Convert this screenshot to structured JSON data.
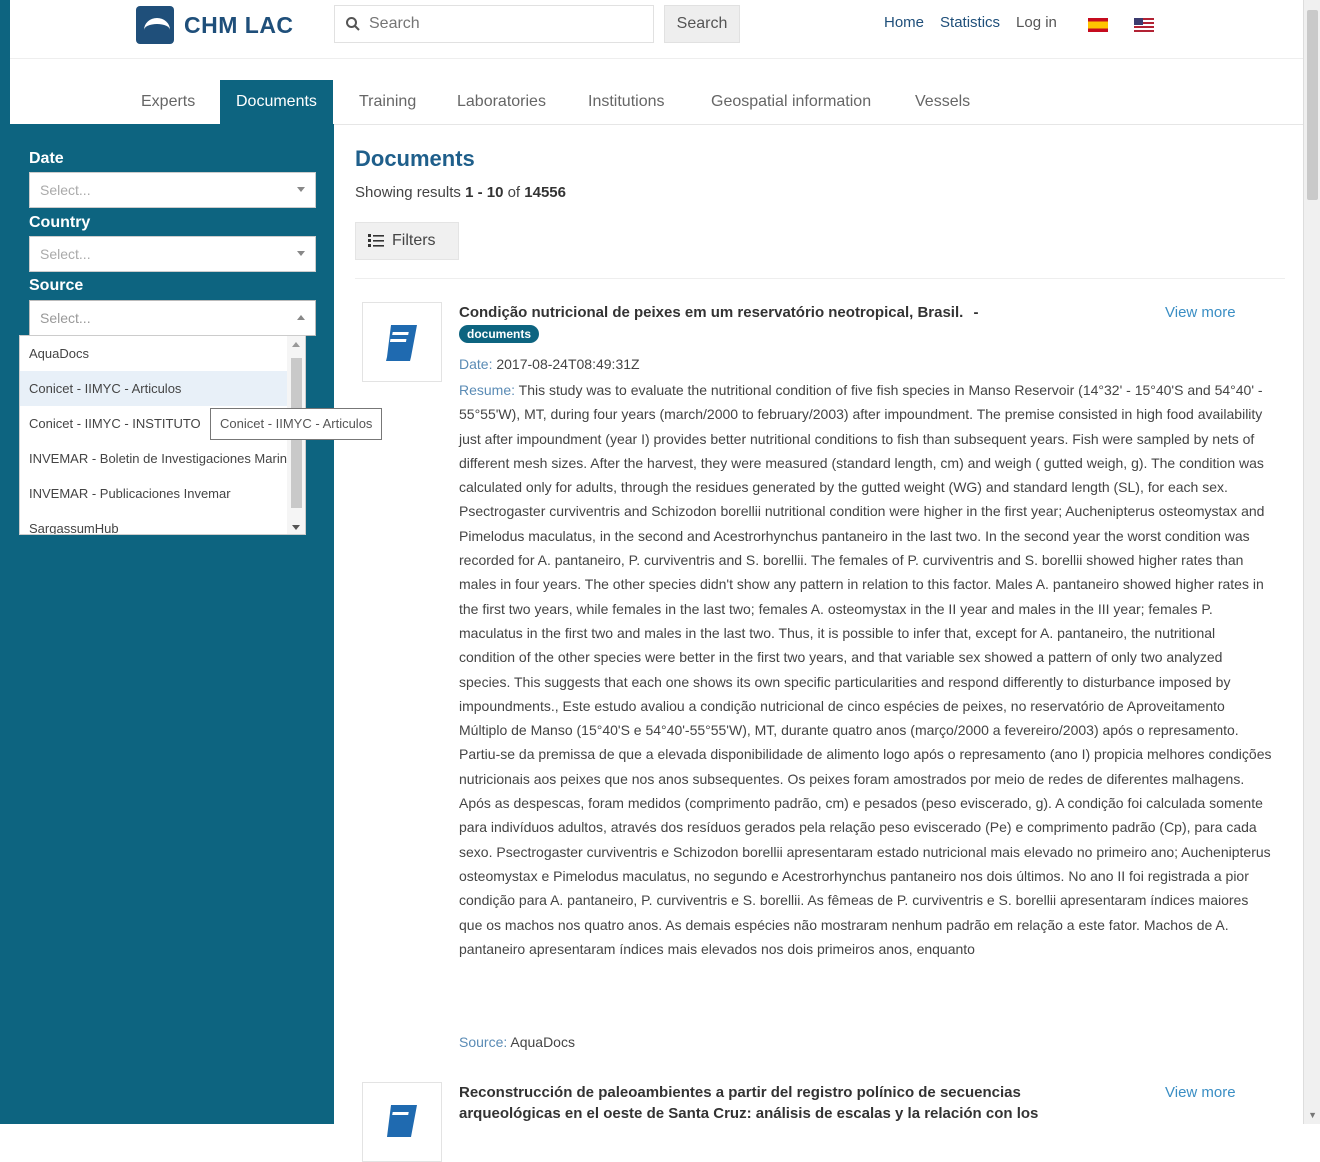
{
  "header": {
    "logo_text": "CHM LAC",
    "search_placeholder": "Search",
    "search_button": "Search",
    "nav": [
      "Home",
      "Statistics",
      "Log in"
    ]
  },
  "tabs": [
    "Experts",
    "Documents",
    "Training",
    "Laboratories",
    "Institutions",
    "Geospatial information",
    "Vessels"
  ],
  "active_tab": "Documents",
  "sidebar": {
    "date": {
      "label": "Date",
      "placeholder": "Select..."
    },
    "country": {
      "label": "Country",
      "placeholder": "Select..."
    },
    "source": {
      "label": "Source",
      "placeholder": "Select...",
      "options": [
        "AquaDocs",
        "Conicet - IIMYC - Articulos",
        "Conicet - IIMYC - INSTITUTO",
        "INVEMAR - Boletin de Investigaciones Marinas",
        "INVEMAR - Publicaciones Invemar",
        "SargassumHub"
      ],
      "hovered_option": "Conicet - IIMYC - Articulos",
      "tooltip": "Conicet - IIMYC - Articulos"
    }
  },
  "main": {
    "title": "Documents",
    "results_prefix": "Showing results",
    "results_range": "1 - 10",
    "results_of": "of",
    "results_total": "14556",
    "filters_button": "Filters",
    "documents": [
      {
        "title": "Condição nutricional de peixes em um reservatório neotropical, Brasil.",
        "title_suffix": "-",
        "badge": "documents",
        "view_more": "View more",
        "date_label": "Date:",
        "date": "2017-08-24T08:49:31Z",
        "resume_label": "Resume:",
        "resume": "This study was to evaluate the nutritional condition of five fish species in Manso Reservoir (14°32' - 15°40'S and 54°40' - 55°55'W), MT, during four years (march/2000 to february/2003) after impoundment. The premise consisted in high food availability just after impoundment (year I) provides better nutritional conditions to fish than subsequent years. Fish were sampled by nets of different mesh sizes. After the harvest, they were measured (standard length, cm) and weigh ( gutted weigh, g). The condition was calculated only for adults, through the residues generated by the gutted weight (WG) and standard length (SL), for each sex. Psectrogaster curviventris and Schizodon borellii nutritional condition were higher in the first year; Auchenipterus osteomystax and Pimelodus maculatus, in the second and Acestrorhynchus pantaneiro in the last two. In the second year the worst condition was recorded for A. pantaneiro, P. curviventris and S. borellii. The females of P. curviventris and S. borellii showed higher rates than males in four years. The other species didn't show any pattern in relation to this factor. Males A. pantaneiro showed higher rates in the first two years, while females in the last two; females A. osteomystax in the II year and males in the III year; females P. maculatus in the first two and males in the last two. Thus, it is possible to infer that, except for A. pantaneiro, the nutritional condition of the other species were better in the first two years, and that variable sex showed a pattern of only two analyzed species. This suggests that each one shows its own specific particularities and respond differently to disturbance imposed by impoundments., Este estudo avaliou a condição nutricional de cinco espécies de peixes, no reservatório de Aproveitamento Múltiplo de Manso (15°40'S e 54°40'-55°55'W), MT, durante quatro anos (março/2000 a fevereiro/2003) após o represamento. Partiu-se da premissa de que a elevada disponibilidade de alimento logo após o represamento (ano I) propicia melhores condições nutricionais aos peixes que nos anos subsequentes. Os peixes foram amostrados por meio de redes de diferentes malhagens. Após as despescas, foram medidos (comprimento padrão, cm) e pesados (peso eviscerado, g). A condição foi calculada somente para indivíduos adultos, através dos resíduos gerados pela relação peso eviscerado (Pe) e comprimento padrão (Cp), para cada sexo. Psectrogaster curviventris e Schizodon borellii apresentaram estado nutricional mais elevado no primeiro ano; Auchenipterus osteomystax e Pimelodus maculatus, no segundo e Acestrorhynchus pantaneiro nos dois últimos. No ano II foi registrada a pior condição para A. pantaneiro, P. curviventris e S. borellii. As fêmeas de P. curviventris e S. borellii apresentaram índices maiores que os machos nos quatro anos. As demais espécies não mostraram nenhum padrão em relação a este fator. Machos de A. pantaneiro apresentaram índices mais elevados nos dois primeiros anos, enquanto",
        "source_label": "Source:",
        "source": "AquaDocs"
      },
      {
        "title": "Reconstrucción de paleoambientes a partir del registro polínico de secuencias arqueológicas en el oeste de Santa Cruz: análisis de escalas y la relación con los",
        "view_more": "View more"
      }
    ]
  },
  "colors": {
    "primary": "#0d6480",
    "link": "#3a8ec4",
    "title": "#1f5f8b"
  },
  "icons": [
    "search-icon",
    "filter-lines-icon",
    "book-icon",
    "flag-es-icon",
    "flag-us-icon",
    "chevron-down-icon",
    "chevron-up-icon"
  ]
}
